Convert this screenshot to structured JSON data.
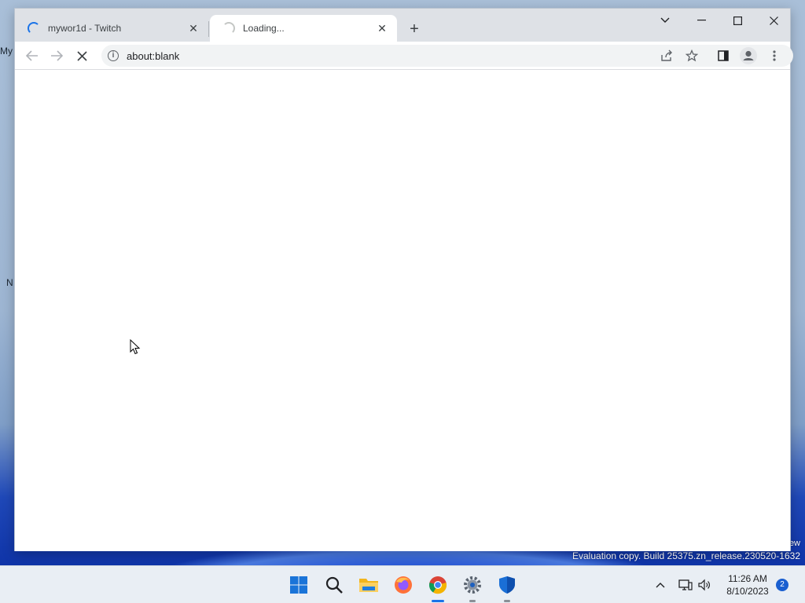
{
  "desktop": {
    "fragments": [
      "My",
      "N"
    ],
    "watermark_line1": "ew",
    "watermark_line2": "Evaluation copy. Build 25375.zn_release.230520-1632"
  },
  "browser": {
    "tabs": [
      {
        "title": "mywor1d - Twitch",
        "state": "loading",
        "active": false
      },
      {
        "title": "Loading...",
        "state": "loading",
        "active": true
      }
    ],
    "address_bar": {
      "value": "about:blank"
    }
  },
  "taskbar": {
    "apps": [
      "start-icon",
      "search-icon",
      "file-explorer-icon",
      "firefox-icon",
      "chrome-icon",
      "settings-icon",
      "defender-icon"
    ],
    "clock": {
      "time": "11:26 AM",
      "date": "8/10/2023"
    },
    "notification_count": "2"
  },
  "colors": {
    "accent": "#1a73e8",
    "tabstrip": "#dee1e6",
    "taskbar": "#e9eef4"
  }
}
